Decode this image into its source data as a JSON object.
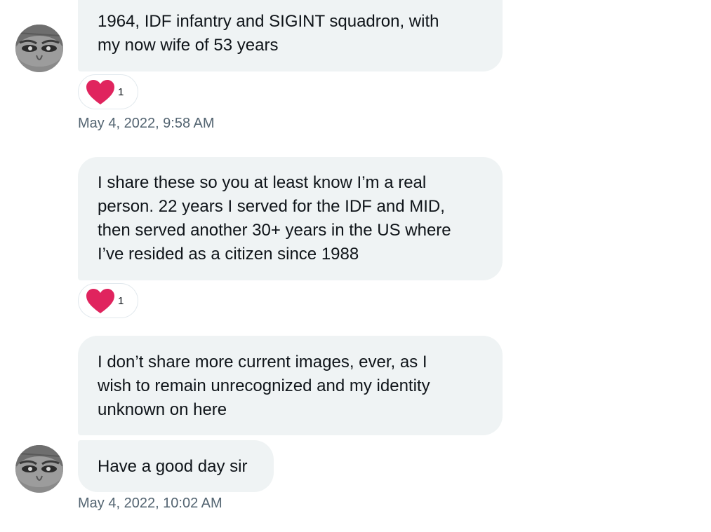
{
  "messages": [
    {
      "lines": [
        "1964, IDF infantry and SIGINT squadron, with",
        "my now wife of 53 years"
      ],
      "reaction": {
        "icon": "heart-icon",
        "count": "1"
      },
      "timestamp": "May 4, 2022, 9:58 AM"
    },
    {
      "lines": [
        "I share these so you at least know I’m a real",
        "person. 22 years I served for the IDF and MID,",
        "then served another 30+ years in the US where",
        "I’ve resided as a citizen since 1988"
      ],
      "reaction": {
        "icon": "heart-icon",
        "count": "1"
      }
    },
    {
      "lines": [
        "I don’t share more current images, ever, as I",
        "wish to remain unrecognized and my identity",
        "unknown on here"
      ]
    },
    {
      "lines": [
        "Have a good day sir"
      ],
      "timestamp": "May 4, 2022, 10:02 AM"
    }
  ],
  "colors": {
    "bubble_bg": "#eff3f4",
    "text": "#0f1419",
    "timestamp": "#536471",
    "heart": "#e0245e"
  }
}
